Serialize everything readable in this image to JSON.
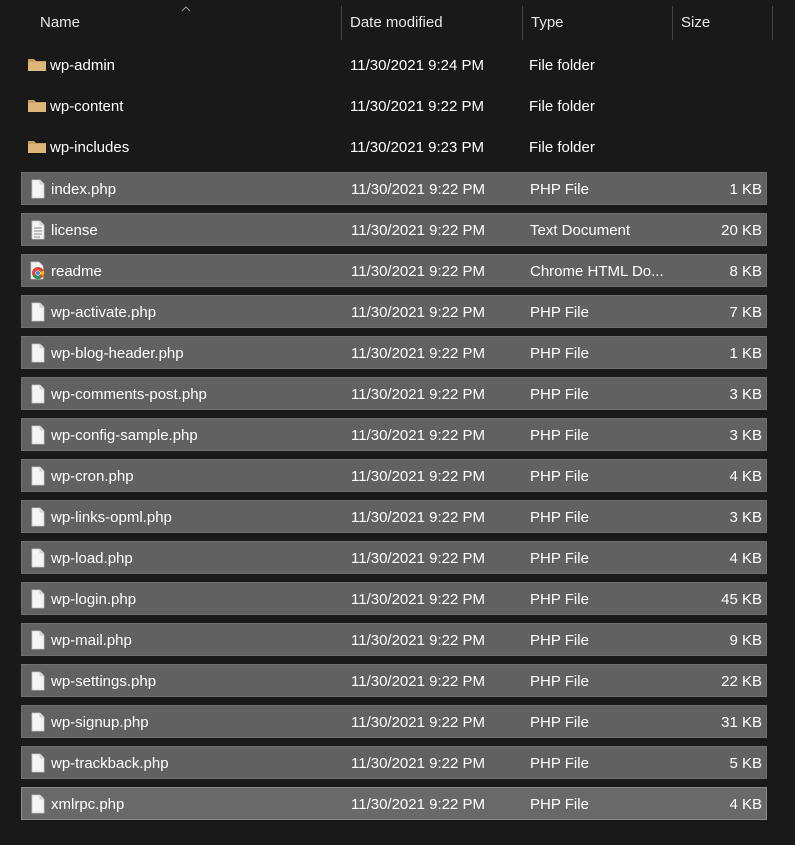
{
  "columns": {
    "name": "Name",
    "date": "Date modified",
    "type": "Type",
    "size": "Size"
  },
  "files": [
    {
      "name": "wp-admin",
      "date": "11/30/2021 9:24 PM",
      "type": "File folder",
      "size": "",
      "icon": "folder-icon",
      "selected": false
    },
    {
      "name": "wp-content",
      "date": "11/30/2021 9:22 PM",
      "type": "File folder",
      "size": "",
      "icon": "folder-icon",
      "selected": false
    },
    {
      "name": "wp-includes",
      "date": "11/30/2021 9:23 PM",
      "type": "File folder",
      "size": "",
      "icon": "folder-icon",
      "selected": false
    },
    {
      "name": "index.php",
      "date": "11/30/2021 9:22 PM",
      "type": "PHP File",
      "size": "1 KB",
      "icon": "file-icon",
      "selected": true
    },
    {
      "name": "license",
      "date": "11/30/2021 9:22 PM",
      "type": "Text Document",
      "size": "20 KB",
      "icon": "text-document-icon",
      "selected": true
    },
    {
      "name": "readme",
      "date": "11/30/2021 9:22 PM",
      "type": "Chrome HTML Do...",
      "size": "8 KB",
      "icon": "chrome-html-icon",
      "selected": true
    },
    {
      "name": "wp-activate.php",
      "date": "11/30/2021 9:22 PM",
      "type": "PHP File",
      "size": "7 KB",
      "icon": "file-icon",
      "selected": true
    },
    {
      "name": "wp-blog-header.php",
      "date": "11/30/2021 9:22 PM",
      "type": "PHP File",
      "size": "1 KB",
      "icon": "file-icon",
      "selected": true
    },
    {
      "name": "wp-comments-post.php",
      "date": "11/30/2021 9:22 PM",
      "type": "PHP File",
      "size": "3 KB",
      "icon": "file-icon",
      "selected": true
    },
    {
      "name": "wp-config-sample.php",
      "date": "11/30/2021 9:22 PM",
      "type": "PHP File",
      "size": "3 KB",
      "icon": "file-icon",
      "selected": true
    },
    {
      "name": "wp-cron.php",
      "date": "11/30/2021 9:22 PM",
      "type": "PHP File",
      "size": "4 KB",
      "icon": "file-icon",
      "selected": true
    },
    {
      "name": "wp-links-opml.php",
      "date": "11/30/2021 9:22 PM",
      "type": "PHP File",
      "size": "3 KB",
      "icon": "file-icon",
      "selected": true
    },
    {
      "name": "wp-load.php",
      "date": "11/30/2021 9:22 PM",
      "type": "PHP File",
      "size": "4 KB",
      "icon": "file-icon",
      "selected": true
    },
    {
      "name": "wp-login.php",
      "date": "11/30/2021 9:22 PM",
      "type": "PHP File",
      "size": "45 KB",
      "icon": "file-icon",
      "selected": true
    },
    {
      "name": "wp-mail.php",
      "date": "11/30/2021 9:22 PM",
      "type": "PHP File",
      "size": "9 KB",
      "icon": "file-icon",
      "selected": true
    },
    {
      "name": "wp-settings.php",
      "date": "11/30/2021 9:22 PM",
      "type": "PHP File",
      "size": "22 KB",
      "icon": "file-icon",
      "selected": true
    },
    {
      "name": "wp-signup.php",
      "date": "11/30/2021 9:22 PM",
      "type": "PHP File",
      "size": "31 KB",
      "icon": "file-icon",
      "selected": true
    },
    {
      "name": "wp-trackback.php",
      "date": "11/30/2021 9:22 PM",
      "type": "PHP File",
      "size": "5 KB",
      "icon": "file-icon",
      "selected": true
    },
    {
      "name": "xmlrpc.php",
      "date": "11/30/2021 9:22 PM",
      "type": "PHP File",
      "size": "4 KB",
      "icon": "file-icon",
      "selected": true,
      "focused": true
    }
  ],
  "colors": {
    "background": "#191919",
    "selection": "#616161",
    "folder": "#dcb67a"
  }
}
